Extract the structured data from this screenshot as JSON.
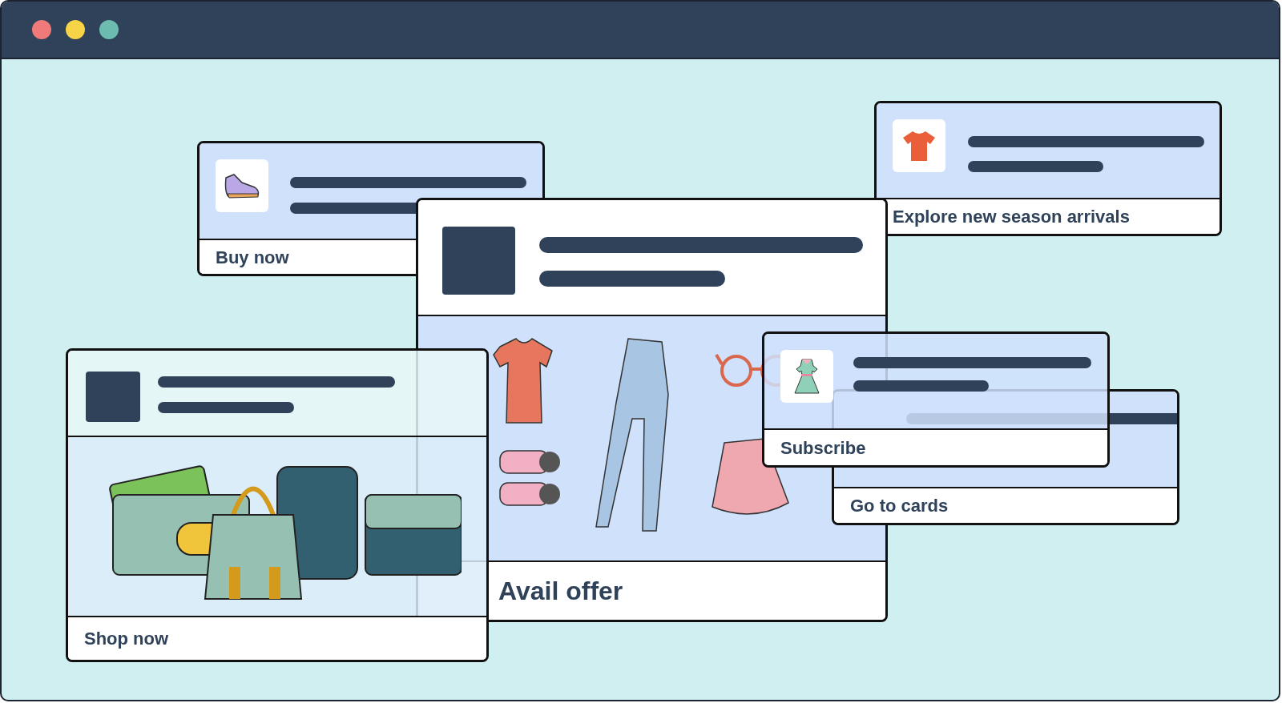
{
  "cards": [
    {
      "label": "Buy now"
    },
    {
      "label": "Explore new season arrivals"
    },
    {
      "label": "Avail offer"
    },
    {
      "label": "Shop now"
    },
    {
      "label": "Subscribe"
    },
    {
      "label": "Go to cards"
    }
  ]
}
